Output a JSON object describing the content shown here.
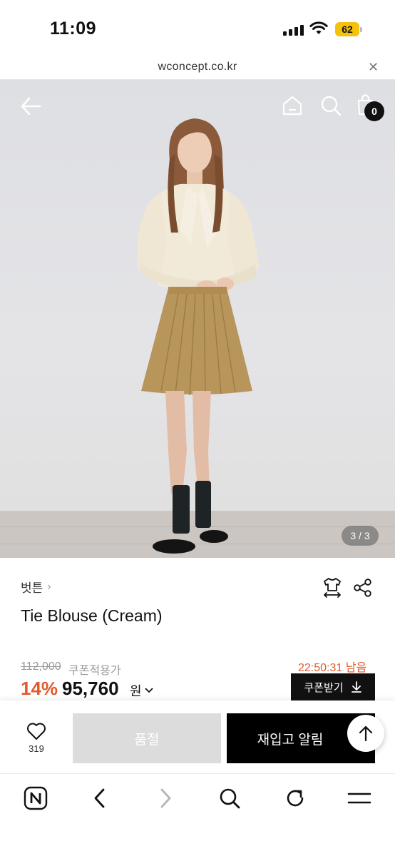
{
  "status_bar": {
    "time": "11:09",
    "battery": "62"
  },
  "browser": {
    "url": "wconcept.co.kr",
    "close_icon": "close-icon"
  },
  "product_image": {
    "counter": "3 / 3",
    "cart_count": "0"
  },
  "product": {
    "brand": "벗튼",
    "name": "Tie Blouse (Cream)",
    "original_price": "112,000",
    "coupon_label": "쿠폰적용가",
    "timer": "22:50:31 남음",
    "discount": "14%",
    "sale_price": "95,760",
    "currency": "원",
    "coupon_button": "쿠폰받기"
  },
  "actions": {
    "like_count": "319",
    "soldout_label": "품절",
    "restock_label": "재입고 알림"
  },
  "colors": {
    "accent": "#e2592a",
    "dark": "#111111",
    "soldout": "#dcdcdc",
    "battery": "#f4c20d"
  },
  "icons": [
    "back-arrow-icon",
    "home-icon",
    "search-icon",
    "cart-icon",
    "size-guide-icon",
    "share-icon",
    "heart-icon",
    "arrow-up-icon",
    "naver-n-icon",
    "chevron-left-icon",
    "chevron-right-icon",
    "refresh-icon",
    "menu-icon"
  ]
}
